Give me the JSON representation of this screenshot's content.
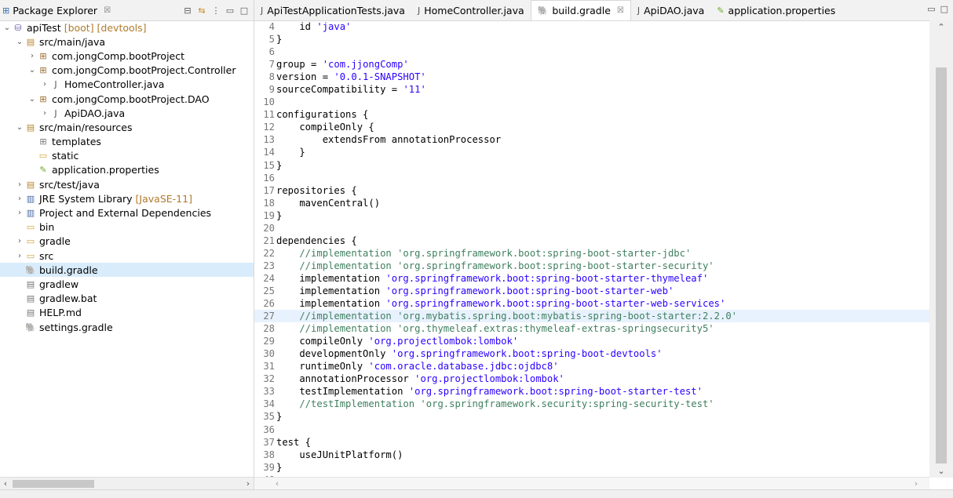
{
  "explorer": {
    "title": "Package Explorer",
    "close": "☒",
    "tree": [
      {
        "label": "apiTest",
        "deco": "[boot] [devtools]",
        "indent": 0,
        "chev": "⌄",
        "icon": "project-icon",
        "glyph": "⛁",
        "color": "#6b5aa6"
      },
      {
        "label": "src/main/java",
        "indent": 1,
        "chev": "⌄",
        "icon": "source-folder-icon",
        "glyph": "▤",
        "color": "#b8862e"
      },
      {
        "label": "com.jongComp.bootProject",
        "indent": 2,
        "chev": "›",
        "icon": "package-icon",
        "glyph": "⊞",
        "color": "#9a6b2e"
      },
      {
        "label": "com.jongComp.bootProject.Controller",
        "indent": 2,
        "chev": "⌄",
        "icon": "package-icon",
        "glyph": "⊞",
        "color": "#9a6b2e"
      },
      {
        "label": "HomeController.java",
        "indent": 3,
        "chev": "›",
        "icon": "java-file-icon",
        "glyph": "J",
        "color": "#555"
      },
      {
        "label": "com.jongComp.bootProject.DAO",
        "indent": 2,
        "chev": "⌄",
        "icon": "package-icon",
        "glyph": "⊞",
        "color": "#9a6b2e"
      },
      {
        "label": "ApiDAO.java",
        "indent": 3,
        "chev": "›",
        "icon": "java-file-icon",
        "glyph": "J",
        "color": "#555"
      },
      {
        "label": "src/main/resources",
        "indent": 1,
        "chev": "⌄",
        "icon": "source-folder-icon",
        "glyph": "▤",
        "color": "#b8862e"
      },
      {
        "label": "templates",
        "indent": 2,
        "chev": "",
        "icon": "folder-icon",
        "glyph": "⊞",
        "color": "#777"
      },
      {
        "label": "static",
        "indent": 2,
        "chev": "",
        "icon": "folder-icon",
        "glyph": "▭",
        "color": "#d1a233"
      },
      {
        "label": "application.properties",
        "indent": 2,
        "chev": "",
        "icon": "properties-file-icon",
        "glyph": "✎",
        "color": "#6aaa2a"
      },
      {
        "label": "src/test/java",
        "indent": 1,
        "chev": "›",
        "icon": "source-folder-icon",
        "glyph": "▤",
        "color": "#b8862e"
      },
      {
        "label": "JRE System Library",
        "deco": "[JavaSE-11]",
        "indent": 1,
        "chev": "›",
        "icon": "library-icon",
        "glyph": "▥",
        "color": "#4a6aa6"
      },
      {
        "label": "Project and External Dependencies",
        "indent": 1,
        "chev": "›",
        "icon": "library-icon",
        "glyph": "▥",
        "color": "#4a6aa6"
      },
      {
        "label": "bin",
        "indent": 1,
        "chev": "",
        "icon": "folder-icon",
        "glyph": "▭",
        "color": "#d1a233"
      },
      {
        "label": "gradle",
        "indent": 1,
        "chev": "›",
        "icon": "folder-icon",
        "glyph": "▭",
        "color": "#d1a233"
      },
      {
        "label": "src",
        "indent": 1,
        "chev": "›",
        "icon": "folder-icon",
        "glyph": "▭",
        "color": "#d1a233"
      },
      {
        "label": "build.gradle",
        "indent": 1,
        "chev": "",
        "icon": "gradle-file-icon",
        "glyph": "🐘",
        "color": "#0b3d5c",
        "selected": true
      },
      {
        "label": "gradlew",
        "indent": 1,
        "chev": "",
        "icon": "file-icon",
        "glyph": "▤",
        "color": "#777"
      },
      {
        "label": "gradlew.bat",
        "indent": 1,
        "chev": "",
        "icon": "file-icon",
        "glyph": "▤",
        "color": "#777"
      },
      {
        "label": "HELP.md",
        "indent": 1,
        "chev": "",
        "icon": "file-icon",
        "glyph": "▤",
        "color": "#777"
      },
      {
        "label": "settings.gradle",
        "indent": 1,
        "chev": "",
        "icon": "gradle-file-icon",
        "glyph": "🐘",
        "color": "#0b3d5c"
      }
    ]
  },
  "tabs": [
    {
      "label": "ApiTestApplicationTests.java",
      "icon": "java-file-icon",
      "glyph": "J"
    },
    {
      "label": "HomeController.java",
      "icon": "java-file-icon",
      "glyph": "J"
    },
    {
      "label": "build.gradle",
      "icon": "gradle-file-icon",
      "glyph": "🐘",
      "active": true,
      "close": "☒"
    },
    {
      "label": "ApiDAO.java",
      "icon": "java-file-icon",
      "glyph": "J"
    },
    {
      "label": "application.properties",
      "icon": "properties-file-icon",
      "glyph": "✎"
    }
  ],
  "editor": {
    "highlight_line": 27,
    "lines": [
      {
        "n": "4",
        "parts": [
          [
            "t",
            "    id "
          ],
          [
            "s",
            "'java'"
          ]
        ]
      },
      {
        "n": "5",
        "parts": [
          [
            "t",
            "}"
          ]
        ]
      },
      {
        "n": "6",
        "parts": []
      },
      {
        "n": "7",
        "parts": [
          [
            "t",
            "group = "
          ],
          [
            "s",
            "'com.jjongComp'"
          ]
        ]
      },
      {
        "n": "8",
        "parts": [
          [
            "t",
            "version = "
          ],
          [
            "s",
            "'0.0.1-SNAPSHOT'"
          ]
        ]
      },
      {
        "n": "9",
        "parts": [
          [
            "t",
            "sourceCompatibility = "
          ],
          [
            "s",
            "'11'"
          ]
        ]
      },
      {
        "n": "10",
        "parts": []
      },
      {
        "n": "11",
        "parts": [
          [
            "t",
            "configurations {"
          ]
        ]
      },
      {
        "n": "12",
        "parts": [
          [
            "t",
            "    compileOnly {"
          ]
        ]
      },
      {
        "n": "13",
        "parts": [
          [
            "t",
            "        extendsFrom annotationProcessor"
          ]
        ]
      },
      {
        "n": "14",
        "parts": [
          [
            "t",
            "    }"
          ]
        ]
      },
      {
        "n": "15",
        "parts": [
          [
            "t",
            "}"
          ]
        ]
      },
      {
        "n": "16",
        "parts": []
      },
      {
        "n": "17",
        "parts": [
          [
            "t",
            "repositories {"
          ]
        ]
      },
      {
        "n": "18",
        "parts": [
          [
            "t",
            "    mavenCentral()"
          ]
        ]
      },
      {
        "n": "19",
        "parts": [
          [
            "t",
            "}"
          ]
        ]
      },
      {
        "n": "20",
        "parts": []
      },
      {
        "n": "21",
        "parts": [
          [
            "t",
            "dependencies {"
          ]
        ]
      },
      {
        "n": "22",
        "parts": [
          [
            "c",
            "    //implementation 'org.springframework.boot:spring-boot-starter-jdbc'"
          ]
        ]
      },
      {
        "n": "23",
        "parts": [
          [
            "c",
            "    //implementation 'org.springframework.boot:spring-boot-starter-security'"
          ]
        ]
      },
      {
        "n": "24",
        "parts": [
          [
            "t",
            "    implementation "
          ],
          [
            "s",
            "'org.springframework.boot:spring-boot-starter-thymeleaf'"
          ]
        ]
      },
      {
        "n": "25",
        "parts": [
          [
            "t",
            "    implementation "
          ],
          [
            "s",
            "'org.springframework.boot:spring-boot-starter-web'"
          ]
        ]
      },
      {
        "n": "26",
        "parts": [
          [
            "t",
            "    implementation "
          ],
          [
            "s",
            "'org.springframework.boot:spring-boot-starter-web-services'"
          ]
        ]
      },
      {
        "n": "27",
        "parts": [
          [
            "c",
            "    //implementation 'org.mybatis.spring.boot:mybatis-spring-boot-starter:2.2.0'"
          ]
        ]
      },
      {
        "n": "28",
        "parts": [
          [
            "c",
            "    //implementation 'org.thymeleaf.extras:thymeleaf-extras-springsecurity5'"
          ]
        ]
      },
      {
        "n": "29",
        "parts": [
          [
            "t",
            "    compileOnly "
          ],
          [
            "s",
            "'org.projectlombok:lombok'"
          ]
        ]
      },
      {
        "n": "30",
        "parts": [
          [
            "t",
            "    developmentOnly "
          ],
          [
            "s",
            "'org.springframework.boot:spring-boot-devtools'"
          ]
        ]
      },
      {
        "n": "31",
        "parts": [
          [
            "t",
            "    runtimeOnly "
          ],
          [
            "s",
            "'com.oracle.database.jdbc:ojdbc8'"
          ]
        ]
      },
      {
        "n": "32",
        "parts": [
          [
            "t",
            "    annotationProcessor "
          ],
          [
            "s",
            "'org.projectlombok:lombok'"
          ]
        ]
      },
      {
        "n": "33",
        "parts": [
          [
            "t",
            "    testImplementation "
          ],
          [
            "s",
            "'org.springframework.boot:spring-boot-starter-test'"
          ]
        ]
      },
      {
        "n": "34",
        "parts": [
          [
            "c",
            "    //testImplementation 'org.springframework.security:spring-security-test'"
          ]
        ]
      },
      {
        "n": "35",
        "parts": [
          [
            "t",
            "}"
          ]
        ]
      },
      {
        "n": "36",
        "parts": []
      },
      {
        "n": "37",
        "parts": [
          [
            "t",
            "test {"
          ]
        ]
      },
      {
        "n": "38",
        "parts": [
          [
            "t",
            "    useJUnitPlatform()"
          ]
        ]
      },
      {
        "n": "39",
        "parts": [
          [
            "t",
            "}"
          ]
        ]
      },
      {
        "n": "40",
        "parts": []
      }
    ]
  }
}
